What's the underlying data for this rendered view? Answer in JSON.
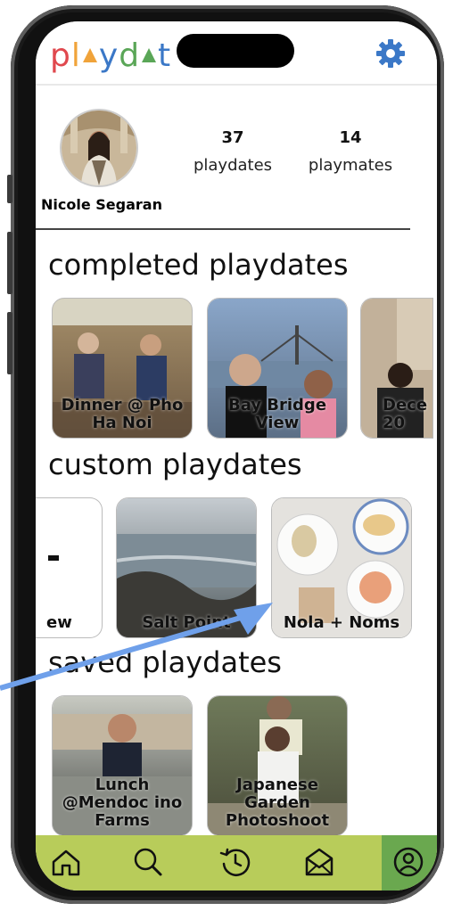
{
  "app": {
    "logo": {
      "p": "p",
      "l": "l",
      "y": "y",
      "d": "d",
      "t": "t"
    }
  },
  "profile": {
    "name": "Nicole Segaran",
    "stats": [
      {
        "value": "37",
        "label": "playdates"
      },
      {
        "value": "14",
        "label": "playmates"
      }
    ]
  },
  "sections": {
    "completed": {
      "title": "completed playdates",
      "cards": [
        {
          "caption": "Dinner @ Pho Ha Noi",
          "palette": [
            "#a7906b",
            "#6e5a43"
          ]
        },
        {
          "caption": "Bay Bridge View",
          "palette": [
            "#8aa6c9",
            "#5c6f86"
          ]
        },
        {
          "caption": "Dece 20",
          "palette": [
            "#c2b19a",
            "#7d6b58"
          ]
        }
      ]
    },
    "custom": {
      "title": "custom playdates",
      "cards": [
        {
          "caption": "ew",
          "palette": [
            "#ffffff",
            "#ffffff"
          ]
        },
        {
          "caption": "Salt Point",
          "palette": [
            "#a8b4bf",
            "#505b5f"
          ]
        },
        {
          "caption": "Nola + Noms",
          "palette": [
            "#f0ece4",
            "#d9d2c5"
          ]
        }
      ]
    },
    "saved": {
      "title": "saved playdates",
      "cards": [
        {
          "caption": "Lunch @Mendoc ino Farms",
          "palette": [
            "#9fa59b",
            "#4b4e4a"
          ]
        },
        {
          "caption": "Japanese Garden Photoshoot",
          "palette": [
            "#8a8e6f",
            "#4a4c3a"
          ]
        }
      ]
    }
  },
  "nav": {
    "items": [
      "home-icon",
      "search-icon",
      "history-icon",
      "mail-icon",
      "profile-icon"
    ],
    "active": "profile-icon",
    "bar_color": "#b8cc5a",
    "active_color": "#6aa84f"
  },
  "colors": {
    "gear": "#3b78c7",
    "arrow": "#6fa0ea"
  }
}
